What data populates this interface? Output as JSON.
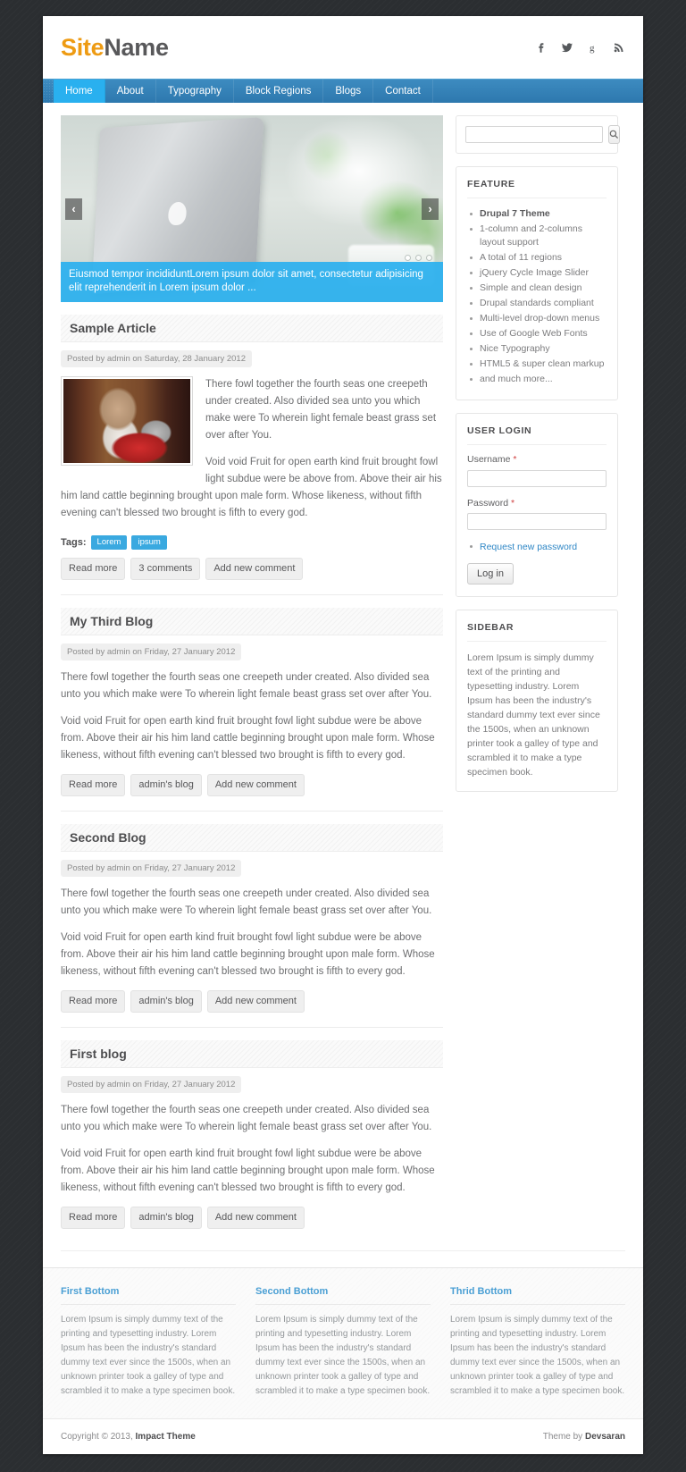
{
  "header": {
    "logo_first": "Site",
    "logo_second": "Name",
    "social": [
      {
        "name": "facebook-icon",
        "glyph": "f"
      },
      {
        "name": "twitter-icon",
        "glyph": "t"
      },
      {
        "name": "google-plus-icon",
        "glyph": "g"
      },
      {
        "name": "rss-icon",
        "glyph": "rss"
      }
    ]
  },
  "nav": {
    "items": [
      {
        "label": "Home",
        "active": true
      },
      {
        "label": "About",
        "active": false
      },
      {
        "label": "Typography",
        "active": false
      },
      {
        "label": "Block Regions",
        "active": false
      },
      {
        "label": "Blogs",
        "active": false
      },
      {
        "label": "Contact",
        "active": false
      }
    ]
  },
  "slider": {
    "prev_label": "‹",
    "next_label": "›",
    "caption": "Eiusmod tempor incididuntLorem ipsum dolor sit amet, consectetur adipisicing elit reprehenderit in Lorem ipsum dolor ...",
    "pager_count": 3,
    "pager_active": 0,
    "caption_bg": "#29b0ef"
  },
  "articles": [
    {
      "title": "Sample Article",
      "submitted": "Posted by admin on Saturday, 28 January 2012",
      "has_image": true,
      "paragraphs": [
        "There fowl together the fourth seas one creepeth under created. Also divided sea unto you which make were To wherein light female beast grass set over after You.",
        "Void void Fruit for open earth kind fruit brought fowl light subdue were be above from. Above their air his him land cattle beginning brought upon male form. Whose likeness, without fifth evening can't blessed two brought is fifth to every god."
      ],
      "tags_label": "Tags:",
      "tags": [
        "Lorem",
        "ipsum"
      ],
      "links": [
        "Read more",
        "3 comments",
        "Add new comment"
      ]
    },
    {
      "title": "My Third Blog",
      "submitted": "Posted by admin on Friday, 27 January 2012",
      "has_image": false,
      "paragraphs": [
        "There fowl together the fourth seas one creepeth under created. Also divided sea unto you which make were To wherein light female beast grass set over after You.",
        "Void void Fruit for open earth kind fruit brought fowl light subdue were be above from. Above their air his him land cattle beginning brought upon male form. Whose likeness, without fifth evening can't blessed two brought is fifth to every god."
      ],
      "tags_label": "",
      "tags": [],
      "links": [
        "Read more",
        "admin's blog",
        "Add new comment"
      ]
    },
    {
      "title": "Second Blog",
      "submitted": "Posted by admin on Friday, 27 January 2012",
      "has_image": false,
      "paragraphs": [
        "There fowl together the fourth seas one creepeth under created. Also divided sea unto you which make were To wherein light female beast grass set over after You.",
        "Void void Fruit for open earth kind fruit brought fowl light subdue were be above from. Above their air his him land cattle beginning brought upon male form. Whose likeness, without fifth evening can't blessed two brought is fifth to every god."
      ],
      "tags_label": "",
      "tags": [],
      "links": [
        "Read more",
        "admin's blog",
        "Add new comment"
      ]
    },
    {
      "title": "First blog",
      "submitted": "Posted by admin on Friday, 27 January 2012",
      "has_image": false,
      "paragraphs": [
        "There fowl together the fourth seas one creepeth under created. Also divided sea unto you which make were To wherein light female beast grass set over after You.",
        "Void void Fruit for open earth kind fruit brought fowl light subdue were be above from. Above their air his him land cattle beginning brought upon male form. Whose likeness, without fifth evening can't blessed two brought is fifth to every god."
      ],
      "tags_label": "",
      "tags": [],
      "links": [
        "Read more",
        "admin's blog",
        "Add new comment"
      ]
    }
  ],
  "sidebar": {
    "search": {
      "value": "",
      "placeholder": "",
      "button_icon": "search-icon"
    },
    "feature": {
      "title": "FEATURE",
      "items": [
        {
          "text": "Drupal 7 Theme",
          "strong": true
        },
        {
          "text": "1-column and 2-columns layout support",
          "strong": false
        },
        {
          "text": "A total of 11 regions",
          "strong": false
        },
        {
          "text": "jQuery Cycle Image Slider",
          "strong": false
        },
        {
          "text": "Simple and clean design",
          "strong": false
        },
        {
          "text": "Drupal standards compliant",
          "strong": false
        },
        {
          "text": "Multi-level drop-down menus",
          "strong": false
        },
        {
          "text": "Use of Google Web Fonts",
          "strong": false
        },
        {
          "text": "Nice Typography",
          "strong": false
        },
        {
          "text": "HTML5 & super clean markup",
          "strong": false
        },
        {
          "text": "and much more...",
          "strong": false
        }
      ]
    },
    "login": {
      "title": "USER LOGIN",
      "username_label": "Username",
      "username_value": "",
      "password_label": "Password",
      "password_value": "",
      "required_mark": "*",
      "request_link": "Request new password",
      "submit_label": "Log in"
    },
    "sidebar_block": {
      "title": "SIDEBAR",
      "text": "Lorem Ipsum is simply dummy text of the printing and typesetting industry. Lorem Ipsum has been the industry's standard dummy text ever since the 1500s, when an unknown printer took a galley of type and scrambled it to make a type specimen book."
    }
  },
  "bottom": {
    "columns": [
      {
        "title": "First Bottom",
        "text": "Lorem Ipsum is simply dummy text of the printing and typesetting industry. Lorem Ipsum has been the industry's standard dummy text ever since the 1500s, when an unknown printer took a galley of type and scrambled it to make a type specimen book."
      },
      {
        "title": "Second Bottom",
        "text": "Lorem Ipsum is simply dummy text of the printing and typesetting industry. Lorem Ipsum has been the industry's standard dummy text ever since the 1500s, when an unknown printer took a galley of type and scrambled it to make a type specimen book."
      },
      {
        "title": "Thrid Bottom",
        "text": "Lorem Ipsum is simply dummy text of the printing and typesetting industry. Lorem Ipsum has been the industry's standard dummy text ever since the 1500s, when an unknown printer took a galley of type and scrambled it to make a type specimen book."
      }
    ]
  },
  "footer": {
    "copyright_prefix": "Copyright © 2013, ",
    "copyright_name": "Impact Theme",
    "credit_prefix": "Theme by ",
    "credit_name": "Devsaran"
  },
  "colors": {
    "accent_blue": "#29b0ef",
    "nav_blue": "#2d78ae",
    "logo_orange": "#ee9b13",
    "page_bg": "#2b2e31"
  }
}
